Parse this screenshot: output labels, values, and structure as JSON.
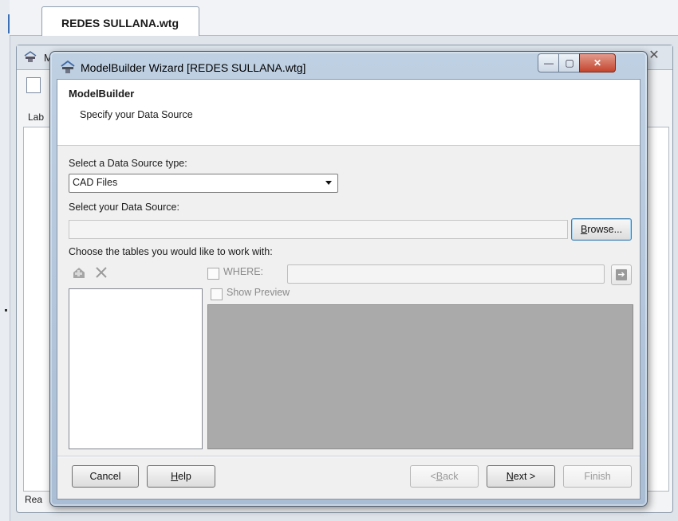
{
  "background_app": {
    "document_tab": "REDES SULLANA.wtg",
    "partial_label": "Lab",
    "partial_status": "Rea",
    "partial_window_letter": "M",
    "close_glyph": "✕"
  },
  "wizard": {
    "title": "ModelBuilder Wizard [REDES SULLANA.wtg]",
    "header_title": "ModelBuilder",
    "header_subtitle": "Specify your Data Source",
    "data_source_type_label": "Select a Data Source type:",
    "data_source_type_value": "CAD Files",
    "data_source_label": "Select your Data Source:",
    "data_source_value": "",
    "browse_prefix": "B",
    "browse_rest": "rowse...",
    "tables_label": "Choose the tables you would like to work with:",
    "where_label": "WHERE:",
    "where_value": "",
    "show_preview_label": "Show Preview",
    "buttons": {
      "cancel": "Cancel",
      "help_prefix": "H",
      "help_rest": "elp",
      "back_pre": "< ",
      "back_acc": "B",
      "back_rest": "ack",
      "next_acc": "N",
      "next_rest": "ext >",
      "finish": "Finish"
    },
    "window_controls": {
      "minimize": "—",
      "maximize": "▢",
      "close": "✕"
    },
    "icons": {
      "add_table": "add-table-icon",
      "remove_table": "delete-icon",
      "go": "arrow-right-icon",
      "title": "modelbuilder-icon"
    }
  }
}
